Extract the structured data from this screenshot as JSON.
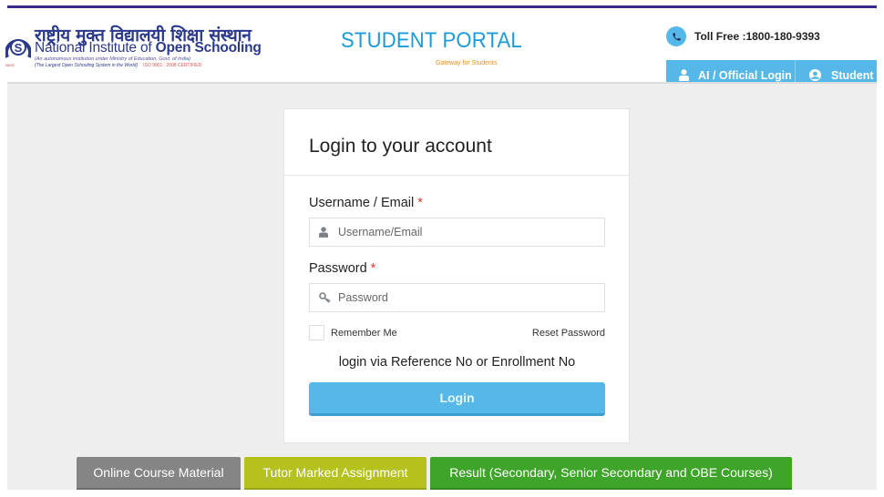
{
  "header": {
    "logo": {
      "hindi_name": "राष्ट्रीय मुक्त विद्यालयी शिक्षा संस्थान",
      "english_name_prefix": "National Institute of ",
      "english_name_bold": "Open Schooling",
      "subtitle_1": "(An autonomous institution under Ministry of Education, Govt. of India)",
      "subtitle_2": "(The Largest Open Schooling System in the World)",
      "subtitle_2_cert": "ISO 9001 : 2008 CERTIFIED",
      "emblem_caption": "NIOS"
    },
    "portal": {
      "title": "STUDENT PORTAL",
      "tagline": "Gateway for Students"
    },
    "toll_free": {
      "icon": "phone-icon",
      "text": "Toll Free :1800-180-9393"
    },
    "nav": [
      {
        "label": "AI / Official Login",
        "icon": "user-icon"
      },
      {
        "label": "Student Login",
        "icon": "user-circle-icon"
      }
    ]
  },
  "login_card": {
    "title": "Login to your account",
    "username": {
      "label": "Username / Email",
      "required_mark": "*",
      "placeholder": "Username/Email",
      "value": "",
      "icon": "user-icon"
    },
    "password": {
      "label": "Password",
      "required_mark": "*",
      "placeholder": "Password",
      "value": "",
      "icon": "key-icon"
    },
    "remember_me": {
      "label": "Remember Me",
      "checked": false
    },
    "reset_password_label": "Reset Password",
    "alt_login_text": "login via Reference No or Enrollment No",
    "login_button_label": "Login"
  },
  "bottom_links": [
    {
      "label": "Online Course Material",
      "color": "#858585"
    },
    {
      "label": "Tutor Marked Assignment",
      "color": "#b5c21e"
    },
    {
      "label": "Result (Secondary, Senior Secondary and OBE Courses)",
      "color": "#3fa42a"
    }
  ],
  "colors": {
    "accent": "#55b8e8",
    "portal_title": "#1e9bd7",
    "portal_tagline": "#f28c1c",
    "brand_navy": "#2b3a8c",
    "required": "#e23b3b"
  }
}
